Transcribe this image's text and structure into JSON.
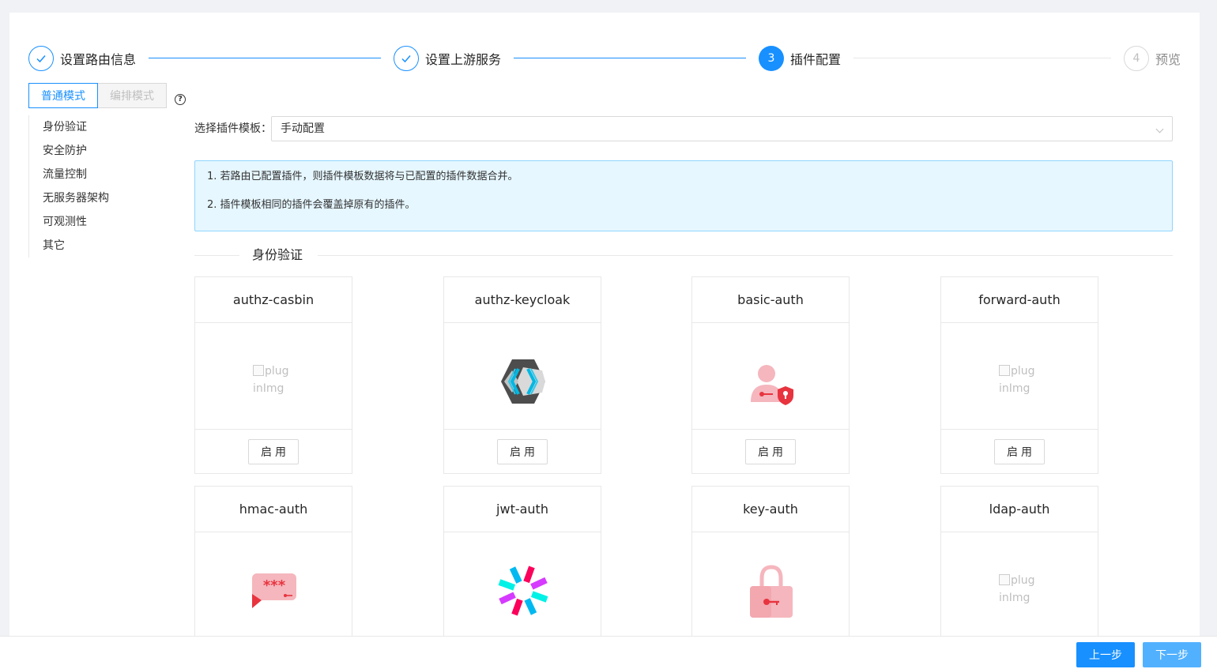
{
  "steps": [
    {
      "label": "设置路由信息",
      "status": "done",
      "icon": "check-icon"
    },
    {
      "label": "设置上游服务",
      "status": "done",
      "icon": "check-icon"
    },
    {
      "label": "插件配置",
      "status": "active",
      "number": "3"
    },
    {
      "label": "预览",
      "status": "wait",
      "number": "4"
    }
  ],
  "modes": {
    "normal": "普通模式",
    "orchestration": "编排模式",
    "help_icon": "?"
  },
  "categories": [
    "身份验证",
    "安全防护",
    "流量控制",
    "无服务器架构",
    "可观测性",
    "其它"
  ],
  "template": {
    "label": "选择插件模板：",
    "value": "手动配置"
  },
  "alert": {
    "line1": "1. 若路由已配置插件，则插件模板数据将与已配置的插件数据合并。",
    "line2": "2. 插件模板相同的插件会覆盖掉原有的插件。"
  },
  "section_title": "身份验证",
  "broken_image_alt": "pluginImg",
  "enable_label": "启用",
  "plugins": [
    {
      "name": "authz-casbin",
      "icon": "broken-image-icon"
    },
    {
      "name": "authz-keycloak",
      "icon": "keycloak-icon"
    },
    {
      "name": "basic-auth",
      "icon": "user-shield-icon"
    },
    {
      "name": "forward-auth",
      "icon": "broken-image-icon"
    },
    {
      "name": "hmac-auth",
      "icon": "password-bubble-icon"
    },
    {
      "name": "jwt-auth",
      "icon": "jwt-icon"
    },
    {
      "name": "key-auth",
      "icon": "padlock-icon"
    },
    {
      "name": "ldap-auth",
      "icon": "broken-image-icon"
    }
  ],
  "footer": {
    "prev": "上一步",
    "next": "下一步"
  },
  "colors": {
    "primary": "#1890ff",
    "alert_bg": "#e6f7ff",
    "alert_border": "#91d5ff",
    "icon_pink": "#f5b6bd",
    "icon_red": "#e8343f"
  }
}
